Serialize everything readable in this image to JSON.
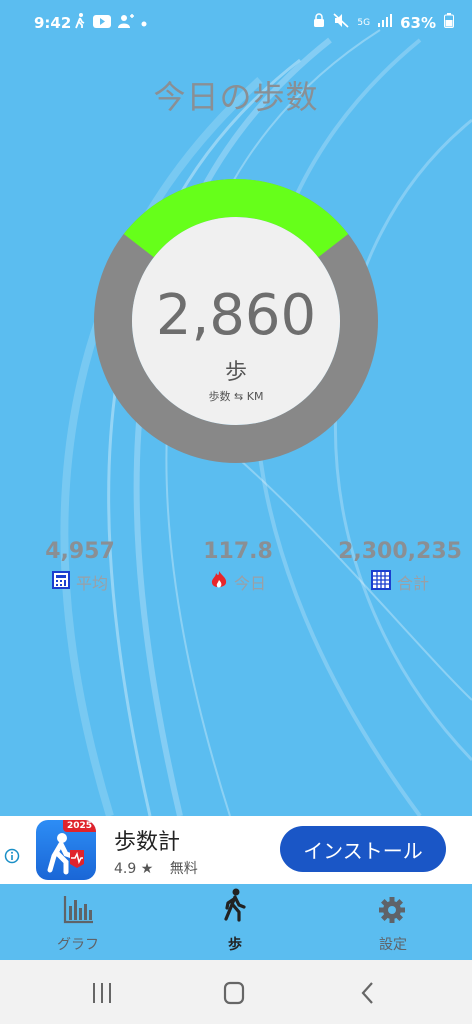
{
  "status_bar": {
    "time": "9:42",
    "battery": "63%",
    "network": "5G"
  },
  "title": "今日の歩数",
  "ring": {
    "step_count": "2,860",
    "unit": "歩",
    "toggle_label": "歩数 ⇆ KM",
    "progress_fraction": 0.29,
    "colors": {
      "progress": "#66ff1a",
      "track": "#888888",
      "inner": "#f0f0f0"
    }
  },
  "stats": {
    "average": {
      "value": "4,957",
      "label": "平均"
    },
    "today": {
      "value": "117.8",
      "label": "今日"
    },
    "total": {
      "value": "2,300,235",
      "label": "合計"
    }
  },
  "ad": {
    "app_name": "歩数計",
    "rating": "4.9 ★",
    "price": "無料",
    "badge": "2025",
    "install_label": "インストール"
  },
  "nav": {
    "graph": "グラフ",
    "steps": "歩",
    "settings": "設定"
  },
  "colors": {
    "background": "#5bbdf0",
    "install_button": "#1a56c6"
  }
}
